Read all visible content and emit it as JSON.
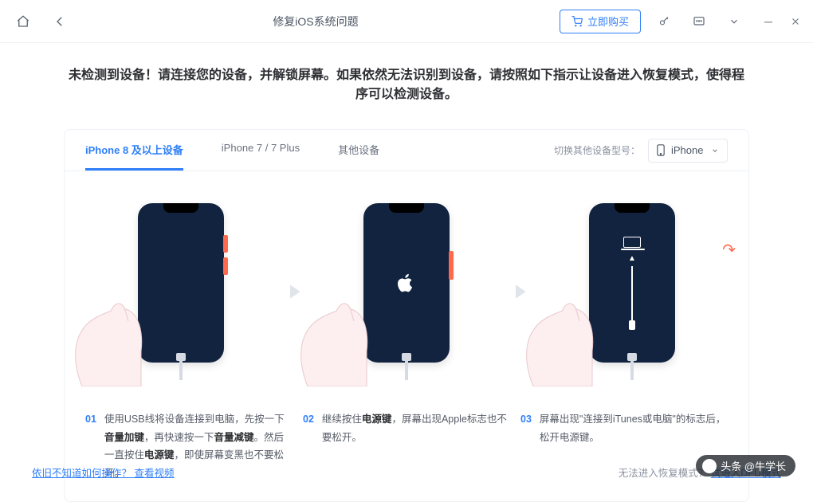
{
  "titlebar": {
    "title": "修复iOS系统问题",
    "buy_label": "立即购买"
  },
  "headline": "未检测到设备！请连接您的设备，并解锁屏幕。如果依然无法识别到设备，请按照如下指示让设备进入恢复模式，使得程序可以检测设备。",
  "tabs": {
    "items": [
      {
        "label": "iPhone 8 及以上设备",
        "active": true
      },
      {
        "label": "iPhone 7 / 7 Plus",
        "active": false
      },
      {
        "label": "其他设备",
        "active": false
      }
    ],
    "switch_label": "切换其他设备型号：",
    "selected_model": "iPhone"
  },
  "steps": [
    {
      "num": "01",
      "text_html": "使用USB线将设备连接到电脑，先按一下<b>音量加键</b>，再快速按一下<b>音量减键</b>。然后一直按住<b>电源键</b>，即使屏幕变黑也不要松开。"
    },
    {
      "num": "02",
      "text_html": "继续按住<b>电源键</b>，屏幕出现Apple标志也不要松开。"
    },
    {
      "num": "03",
      "text_html": "屏幕出现\"连接到iTunes或电脑\"的标志后，松开电源键。"
    }
  ],
  "footer": {
    "left_text": "依旧不知道如何操作？",
    "left_link": "查看视频",
    "right_text": "无法进入恢复模式？",
    "right_link": "试进入DFU模式"
  },
  "watermark": "头条 @牛学长"
}
